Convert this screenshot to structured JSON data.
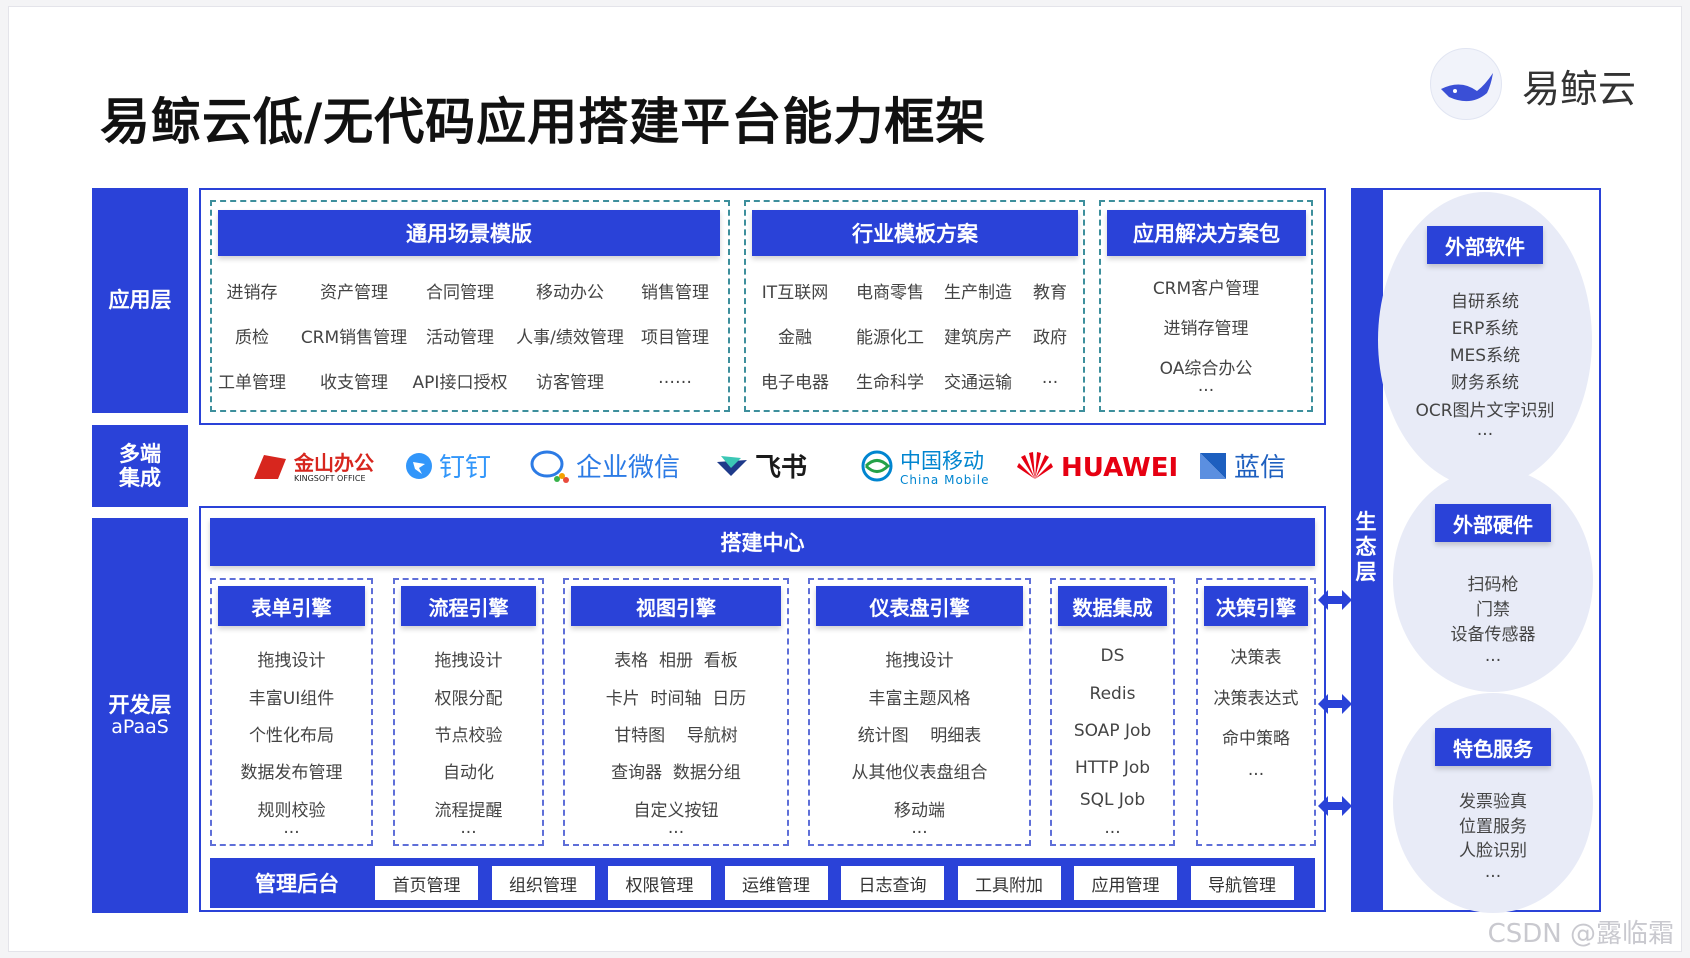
{
  "title": "易鲸云低/无代码应用搭建平台能力框架",
  "logo_text": "易鲸云",
  "layers": {
    "app": "应用层",
    "multi_line1": "多端",
    "multi_line2": "集成",
    "dev": "开发层",
    "dev_sub": "aPaaS",
    "eco_chars": [
      "生",
      "态",
      "层"
    ]
  },
  "general_templates": {
    "header": "通用场景模版",
    "rows": [
      [
        "进销存",
        "资产管理",
        "合同管理",
        "移动办公",
        "销售管理"
      ],
      [
        "质检",
        "CRM销售管理",
        "活动管理",
        "人事/绩效管理",
        "项目管理"
      ],
      [
        "工单管理",
        "收支管理",
        "API接口授权",
        "访客管理",
        "……"
      ]
    ]
  },
  "industry_templates": {
    "header": "行业模板方案",
    "rows": [
      [
        "IT互联网",
        "电商零售",
        "生产制造",
        "教育"
      ],
      [
        "金融",
        "能源化工",
        "建筑房产",
        "政府"
      ],
      [
        "电子电器",
        "生命科学",
        "交通运输",
        "..."
      ]
    ]
  },
  "solutions": {
    "header": "应用解决方案包",
    "items": [
      "CRM客户管理",
      "进销存管理",
      "OA综合办公",
      "..."
    ]
  },
  "integrations": [
    {
      "name": "金山办公",
      "sub": "KINGSOFT OFFICE",
      "icon": "kingsoft-logo-icon",
      "color": "#d7261e"
    },
    {
      "name": "钉钉",
      "icon": "dingtalk-logo-icon",
      "color": "#3296fa"
    },
    {
      "name": "企业微信",
      "icon": "wecom-logo-icon",
      "color": "#2c7be5"
    },
    {
      "name": "飞书",
      "icon": "feishu-logo-icon",
      "color": "#1a1a1a"
    },
    {
      "name": "中国移动",
      "sub": "China Mobile",
      "icon": "china-mobile-logo-icon",
      "color": "#0085d0"
    },
    {
      "name": "HUAWEI",
      "icon": "huawei-logo-icon",
      "color": "#e60012"
    },
    {
      "name": "蓝信",
      "icon": "lanxin-logo-icon",
      "color": "#1d5fbf"
    }
  ],
  "build_center": "搭建中心",
  "engines": [
    {
      "header": "表单引擎",
      "items": [
        "拖拽设计",
        "丰富UI组件",
        "个性化布局",
        "数据发布管理",
        "规则校验",
        "..."
      ]
    },
    {
      "header": "流程引擎",
      "items": [
        "拖拽设计",
        "权限分配",
        "节点校验",
        "自动化",
        "流程提醒",
        "..."
      ]
    },
    {
      "header": "视图引擎",
      "items": [
        "表格  相册  看板",
        "卡片  时间轴  日历",
        "甘特图    导航树",
        "查询器  数据分组",
        "自定义按钮",
        "..."
      ]
    },
    {
      "header": "仪表盘引擎",
      "items": [
        "拖拽设计",
        "丰富主题风格",
        "统计图    明细表",
        "从其他仪表盘组合",
        "移动端",
        "..."
      ]
    },
    {
      "header": "数据集成",
      "items": [
        "DS",
        "Redis",
        "SOAP Job",
        "HTTP Job",
        "SQL Job",
        "..."
      ]
    },
    {
      "header": "决策引擎",
      "items": [
        "决策表",
        "决策表达式",
        "命中策略",
        "..."
      ]
    }
  ],
  "management": {
    "label": "管理后台",
    "items": [
      "首页管理",
      "组织管理",
      "权限管理",
      "运维管理",
      "日志查询",
      "工具附加",
      "应用管理",
      "导航管理"
    ]
  },
  "ecosystem": [
    {
      "header": "外部软件",
      "items": [
        "自研系统",
        "ERP系统",
        "MES系统",
        "财务系统",
        "OCR图片文字识别",
        "..."
      ]
    },
    {
      "header": "外部硬件",
      "items": [
        "扫码枪",
        "门禁",
        "设备传感器",
        "..."
      ]
    },
    {
      "header": "特色服务",
      "items": [
        "发票验真",
        "位置服务",
        "人脸识别",
        "..."
      ]
    }
  ],
  "watermark": "CSDN @露临霜",
  "colors": {
    "primary": "#2a42d8",
    "teal_dash": "#3d8f9c"
  }
}
